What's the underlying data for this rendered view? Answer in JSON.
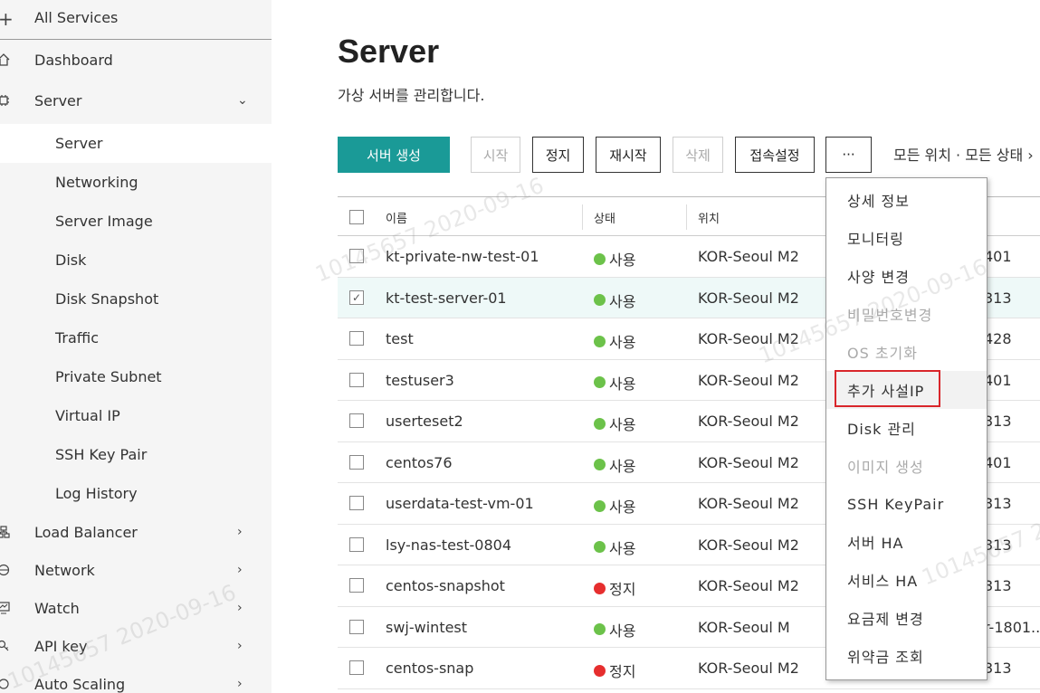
{
  "sidebar": {
    "all_services": "All Services",
    "items": [
      {
        "label": "Dashboard",
        "icon": "home-icon"
      },
      {
        "label": "Server",
        "icon": "chip-icon",
        "expanded": true
      }
    ],
    "sub_items": [
      "Server",
      "Networking",
      "Server Image",
      "Disk",
      "Disk Snapshot",
      "Traffic",
      "Private Subnet",
      "Virtual IP",
      "SSH Key Pair",
      "Log History"
    ],
    "bottom_items": [
      {
        "label": "Load Balancer",
        "icon": "load-balancer-icon"
      },
      {
        "label": "Network",
        "icon": "network-icon"
      },
      {
        "label": "Watch",
        "icon": "watch-icon"
      },
      {
        "label": "API key",
        "icon": "key-icon"
      },
      {
        "label": "Auto Scaling",
        "icon": "auto-scaling-icon"
      }
    ]
  },
  "main": {
    "title": "Server",
    "description": "가상 서버를 관리합니다.",
    "toolbar": {
      "create": "서버 생성",
      "start": "시작",
      "stop": "정지",
      "restart": "재시작",
      "delete": "삭제",
      "connect": "접속설정",
      "more": "···",
      "filter": "모든 위치 · 모든 상태 ›"
    },
    "table": {
      "headers": {
        "name": "이름",
        "status": "상태",
        "location": "위치"
      },
      "rows": [
        {
          "name": "kt-private-nw-test-01",
          "status": "사용",
          "location": "KOR-Seoul M2",
          "extra": "401"
        },
        {
          "name": "kt-test-server-01",
          "status": "사용",
          "location": "KOR-Seoul M2",
          "extra": "313"
        },
        {
          "name": "test",
          "status": "사용",
          "location": "KOR-Seoul M2",
          "extra": "428"
        },
        {
          "name": "testuser3",
          "status": "사용",
          "location": "KOR-Seoul M2",
          "extra": "401"
        },
        {
          "name": "userteset2",
          "status": "사용",
          "location": "KOR-Seoul M2",
          "extra": "313"
        },
        {
          "name": "centos76",
          "status": "사용",
          "location": "KOR-Seoul M2",
          "extra": "401"
        },
        {
          "name": "userdata-test-vm-01",
          "status": "사용",
          "location": "KOR-Seoul M2",
          "extra": "313"
        },
        {
          "name": "lsy-nas-test-0804",
          "status": "사용",
          "location": "KOR-Seoul M2",
          "extra": "313"
        },
        {
          "name": "centos-snapshot",
          "status": "정지",
          "location": "KOR-Seoul M2",
          "extra": "313"
        },
        {
          "name": "swj-wintest",
          "status": "사용",
          "location": "KOR-Seoul M",
          "extra": "r-1801.."
        },
        {
          "name": "centos-snap",
          "status": "정지",
          "location": "KOR-Seoul M2",
          "extra": "313"
        }
      ]
    }
  },
  "dropdown": {
    "items": [
      {
        "label": "상세 정보",
        "disabled": false
      },
      {
        "label": "모니터링",
        "disabled": false
      },
      {
        "label": "사양 변경",
        "disabled": false
      },
      {
        "label": "비밀번호변경",
        "disabled": true
      },
      {
        "label": "OS 초기화",
        "disabled": true
      },
      {
        "label": "추가 사설IP",
        "disabled": false
      },
      {
        "label": "Disk 관리",
        "disabled": false
      },
      {
        "label": "이미지 생성",
        "disabled": true
      },
      {
        "label": "SSH KeyPair",
        "disabled": false
      },
      {
        "label": "서버 HA",
        "disabled": false
      },
      {
        "label": "서비스 HA",
        "disabled": false
      },
      {
        "label": "요금제 변경",
        "disabled": false
      },
      {
        "label": "위약금 조회",
        "disabled": false
      }
    ]
  },
  "watermark": {
    "id": "10145657",
    "date": "2020-09-16"
  },
  "colors": {
    "accent": "#1a9a97",
    "status_active": "#6cc24a",
    "status_stopped": "#e62e2e",
    "highlight": "#d9262b"
  }
}
